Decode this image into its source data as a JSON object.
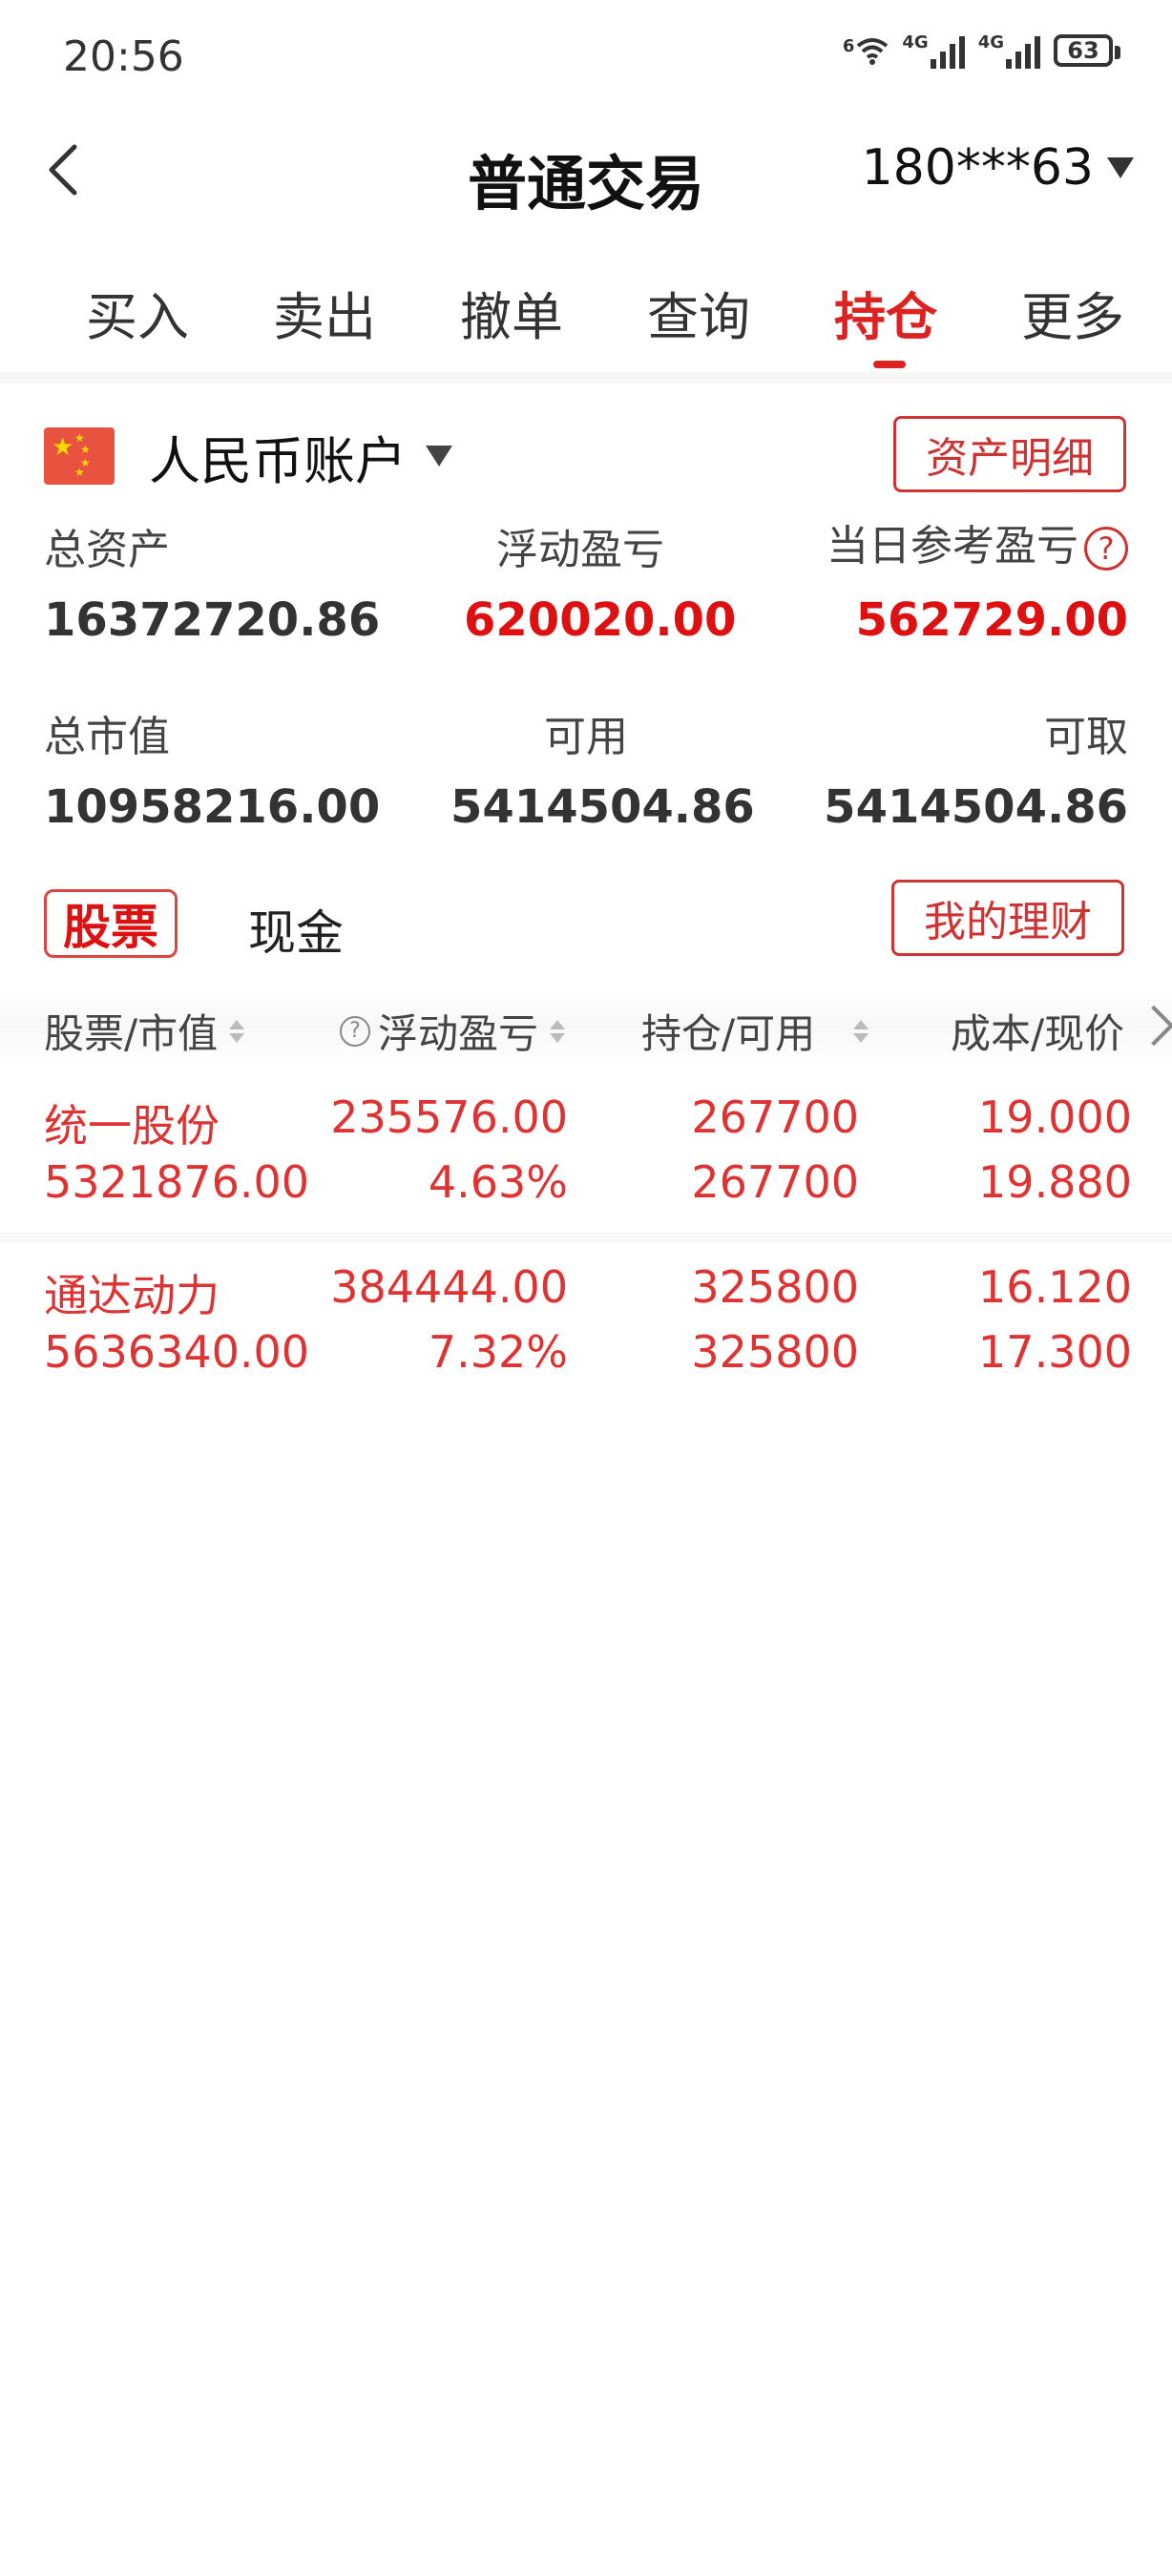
{
  "status_bar": {
    "time": "20:56",
    "battery": "63",
    "network_label": "4G",
    "wifi_label": "6"
  },
  "header": {
    "title": "普通交易",
    "account": "180***63"
  },
  "tabs": [
    {
      "label": "买入",
      "active": false
    },
    {
      "label": "卖出",
      "active": false
    },
    {
      "label": "撤单",
      "active": false
    },
    {
      "label": "查询",
      "active": false
    },
    {
      "label": "持仓",
      "active": true
    },
    {
      "label": "更多",
      "active": false
    }
  ],
  "account_section": {
    "account_type": "人民币账户",
    "asset_detail_button": "资产明细",
    "metrics_row1": {
      "total_assets_label": "总资产",
      "total_assets_value": "16372720.86",
      "floating_pl_label": "浮动盈亏",
      "floating_pl_value": "620020.00",
      "daily_pl_label": "当日参考盈亏",
      "daily_pl_value": "562729.00"
    },
    "metrics_row2": {
      "market_value_label": "总市值",
      "market_value_value": "10958216.00",
      "available_label": "可用",
      "available_value": "5414504.86",
      "withdrawable_label": "可取",
      "withdrawable_value": "5414504.86"
    }
  },
  "segment_tabs": {
    "stocks": "股票",
    "cash": "现金",
    "wealth_button": "我的理财"
  },
  "table": {
    "headers": [
      "股票/市值",
      "浮动盈亏",
      "持仓/可用",
      "成本/现价"
    ],
    "rows": [
      {
        "name": "统一股份",
        "market_value": "5321876.00",
        "pl_amount": "235576.00",
        "pl_percent": "4.63%",
        "position": "267700",
        "available": "267700",
        "cost": "19.000",
        "price": "19.880"
      },
      {
        "name": "通达动力",
        "market_value": "5636340.00",
        "pl_amount": "384444.00",
        "pl_percent": "7.32%",
        "position": "325800",
        "available": "325800",
        "cost": "16.120",
        "price": "17.300"
      }
    ]
  },
  "colors": {
    "accent": "#d22222",
    "text": "#222222"
  }
}
